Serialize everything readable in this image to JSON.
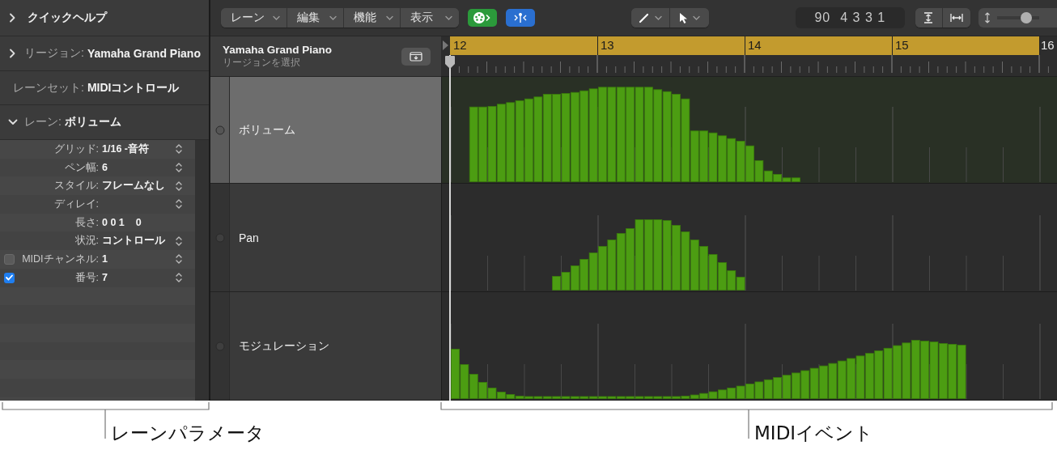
{
  "parameters_panel": {
    "sections": [
      {
        "kind": "disclosure",
        "expanded": false,
        "label": "クイックヘルプ"
      },
      {
        "kind": "disclosure",
        "expanded": false,
        "label": "リージョン:",
        "value": "Yamaha Grand Piano"
      },
      {
        "kind": "plain",
        "label": "レーンセット:",
        "value": "MIDIコントロール"
      },
      {
        "kind": "disclosure",
        "expanded": true,
        "label": "レーン:",
        "value": "ボリューム"
      }
    ],
    "rows": [
      {
        "kind": "stepper",
        "label": "グリッド:",
        "value": "1/16 -音符"
      },
      {
        "kind": "stepper",
        "label": "ペン幅:",
        "value": "6"
      },
      {
        "kind": "stepper",
        "label": "スタイル:",
        "value": "フレームなし"
      },
      {
        "kind": "stepper",
        "label": "ディレイ:"
      },
      {
        "kind": "plain",
        "label": "長さ:",
        "value": "0 0 1    0"
      },
      {
        "kind": "stepper",
        "label": "状況:",
        "value": "コントロール"
      },
      {
        "kind": "checkbox",
        "checked": false,
        "label": "MIDIチャンネル:",
        "value": "1"
      },
      {
        "kind": "checkbox",
        "checked": true,
        "label": "番号:",
        "value": "7"
      }
    ]
  },
  "toolbar": {
    "menus": [
      {
        "label": "レーン"
      },
      {
        "label": "編集"
      },
      {
        "label": "機能"
      },
      {
        "label": "表示"
      }
    ],
    "position_display": [
      "90",
      "4 3 3 1"
    ],
    "zoom_slider": {
      "level": 0.78
    }
  },
  "region_header": {
    "name": "Yamaha Grand Piano",
    "hint": "リージョンを選択"
  },
  "ruler": {
    "bars": [
      "12",
      "13",
      "14",
      "15",
      "16"
    ]
  },
  "lanes": [
    {
      "name": "ボリューム",
      "selected": true
    },
    {
      "name": "Pan",
      "selected": false
    },
    {
      "name": "モジュレーション",
      "selected": false
    }
  ],
  "callouts": [
    {
      "label": "レーンパラメータ"
    },
    {
      "label": "MIDIイベント"
    }
  ]
}
